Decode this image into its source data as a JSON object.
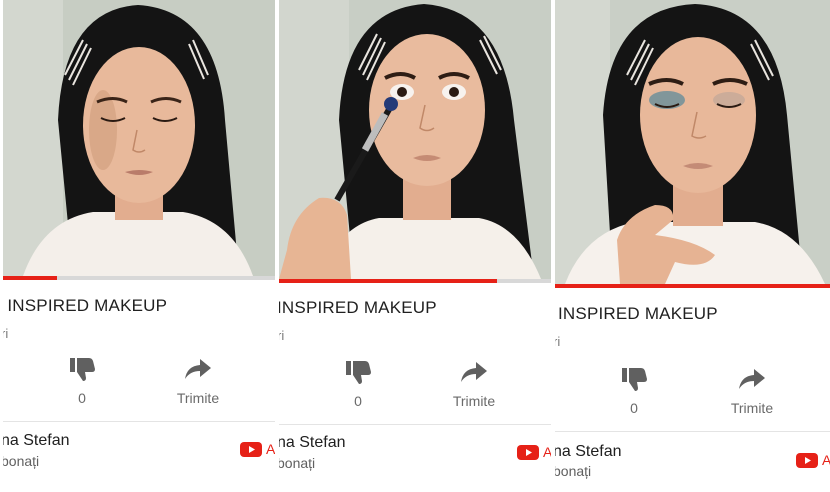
{
  "panels": [
    {
      "title": "' INSPIRED MAKEUP",
      "views": "ri",
      "progress": 0.2,
      "dislike_count": "0",
      "share_label": "Trimite",
      "channel_name": "na Stefan",
      "subscribers": "bonați",
      "subscribe_cut": "A"
    },
    {
      "title": "INSPIRED MAKEUP",
      "views": "ri",
      "progress": 0.8,
      "dislike_count": "0",
      "share_label": "Trimite",
      "channel_name": "na Stefan",
      "subscribers": "bonați",
      "subscribe_cut": "A"
    },
    {
      "title": "INSPIRED MAKEUP",
      "views": "ri",
      "progress": 1.0,
      "dislike_count": "0",
      "share_label": "Trimite",
      "channel_name": "na Stefan",
      "subscribers": "bonați",
      "subscribe_cut": "A"
    }
  ],
  "colors": {
    "progress": "#e62117",
    "youtube_red": "#e62117",
    "skin": "#e8b99b",
    "hair": "#141414",
    "wall": "#c9cfc6"
  },
  "icons": {
    "dislike": "thumbs-down-icon",
    "share": "share-arrow-icon",
    "youtube": "youtube-logo-icon"
  }
}
